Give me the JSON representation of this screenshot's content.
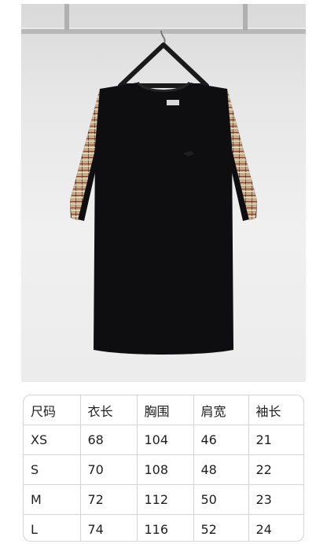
{
  "colors": {
    "shirt": "#0e0e10",
    "plaid_base": "#c7ab86",
    "plaid_stripe": "#7a3b2e",
    "background": "#e9e9e9",
    "table_border": "#d4d4d4"
  },
  "size_table": {
    "headers": [
      "尺码",
      "衣长",
      "胸围",
      "肩宽",
      "袖长"
    ],
    "rows": [
      [
        "XS",
        "68",
        "104",
        "46",
        "21"
      ],
      [
        "S",
        "70",
        "108",
        "48",
        "22"
      ],
      [
        "M",
        "72",
        "112",
        "50",
        "23"
      ],
      [
        "L",
        "74",
        "116",
        "52",
        "24"
      ]
    ]
  }
}
